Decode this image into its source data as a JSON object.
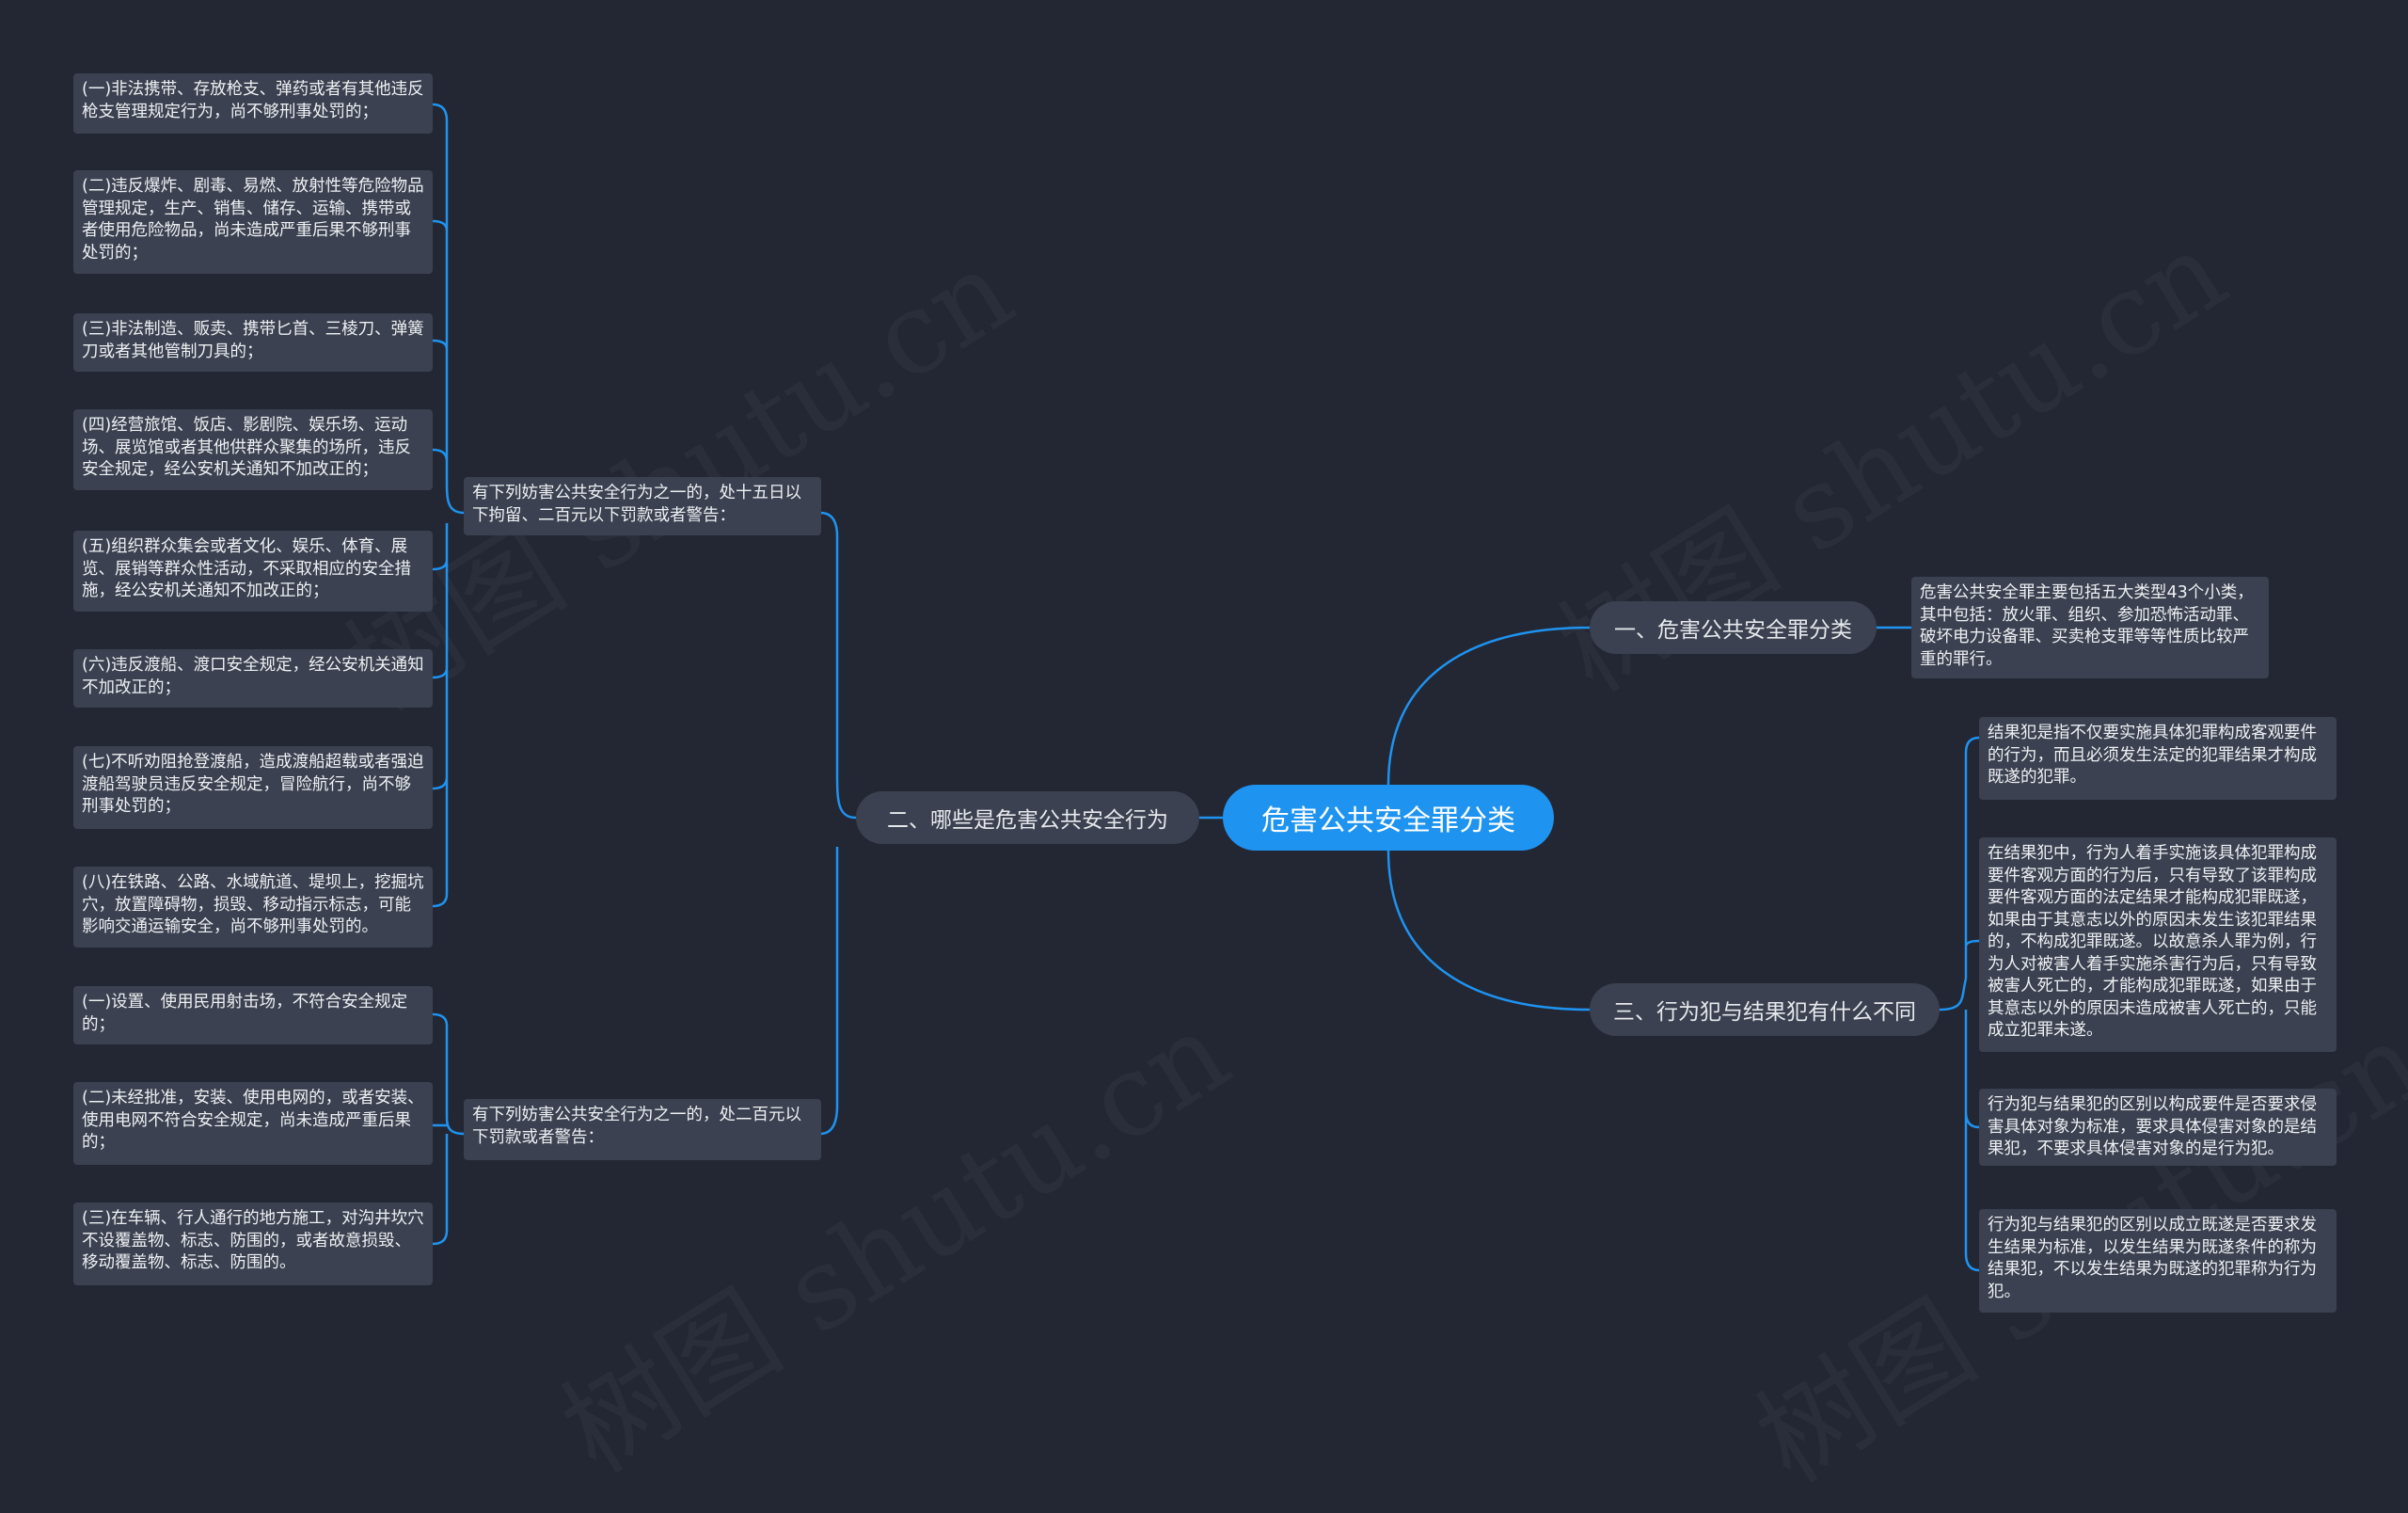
{
  "watermark": "树图 shutu.cn",
  "colors": {
    "background": "#232733",
    "root": "#1e93f0",
    "node": "#3b4150",
    "line": "#1e93f0"
  },
  "root": {
    "label": "危害公共安全罪分类"
  },
  "branch1": {
    "label": "一、危害公共安全罪分类",
    "text": "危害公共安全罪主要包括五大类型43个小类，其中包括：放火罪、组织、参加恐怖活动罪、破坏电力设备罪、买卖枪支罪等等性质比较严重的罪行。"
  },
  "branch2": {
    "label": "二、哪些是危害公共安全行为",
    "group1": {
      "label": "有下列妨害公共安全行为之一的，处十五日以下拘留、二百元以下罚款或者警告：",
      "items": [
        "(一)非法携带、存放枪支、弹药或者有其他违反枪支管理规定行为，尚不够刑事处罚的；",
        "(二)违反爆炸、剧毒、易燃、放射性等危险物品管理规定，生产、销售、储存、运输、携带或者使用危险物品，尚未造成严重后果不够刑事处罚的；",
        "(三)非法制造、贩卖、携带匕首、三棱刀、弹簧刀或者其他管制刀具的；",
        "(四)经营旅馆、饭店、影剧院、娱乐场、运动场、展览馆或者其他供群众聚集的场所，违反安全规定，经公安机关通知不加改正的；",
        "(五)组织群众集会或者文化、娱乐、体育、展览、展销等群众性活动，不采取相应的安全措施，经公安机关通知不加改正的；",
        "(六)违反渡船、渡口安全规定，经公安机关通知不加改正的；",
        "(七)不听劝阻抢登渡船，造成渡船超载或者强迫渡船驾驶员违反安全规定，冒险航行，尚不够刑事处罚的；",
        "(八)在铁路、公路、水域航道、堤坝上，挖掘坑穴，放置障碍物，损毁、移动指示标志，可能影响交通运输安全，尚不够刑事处罚的。"
      ]
    },
    "group2": {
      "label": "有下列妨害公共安全行为之一的，处二百元以下罚款或者警告：",
      "items": [
        "(一)设置、使用民用射击场，不符合安全规定的；",
        "(二)未经批准，安装、使用电网的，或者安装、使用电网不符合安全规定，尚未造成严重后果的；",
        "(三)在车辆、行人通行的地方施工，对沟井坎穴不设覆盖物、标志、防围的，或者故意损毁、移动覆盖物、标志、防围的。"
      ]
    }
  },
  "branch3": {
    "label": "三、行为犯与结果犯有什么不同",
    "items": [
      "结果犯是指不仅要实施具体犯罪构成客观要件的行为，而且必须发生法定的犯罪结果才构成既遂的犯罪。",
      "在结果犯中，行为人着手实施该具体犯罪构成要件客观方面的行为后，只有导致了该罪构成要件客观方面的法定结果才能构成犯罪既遂，如果由于其意志以外的原因未发生该犯罪结果的，不构成犯罪既遂。以故意杀人罪为例，行为人对被害人着手实施杀害行为后，只有导致被害人死亡的，才能构成犯罪既遂，如果由于其意志以外的原因未造成被害人死亡的，只能成立犯罪未遂。",
      "行为犯与结果犯的区别以构成要件是否要求侵害具体对象为标准，要求具体侵害对象的是结果犯，不要求具体侵害对象的是行为犯。",
      "行为犯与结果犯的区别以成立既遂是否要求发生结果为标准，以发生结果为既遂条件的称为结果犯，不以发生结果为既遂的犯罪称为行为犯。"
    ]
  }
}
